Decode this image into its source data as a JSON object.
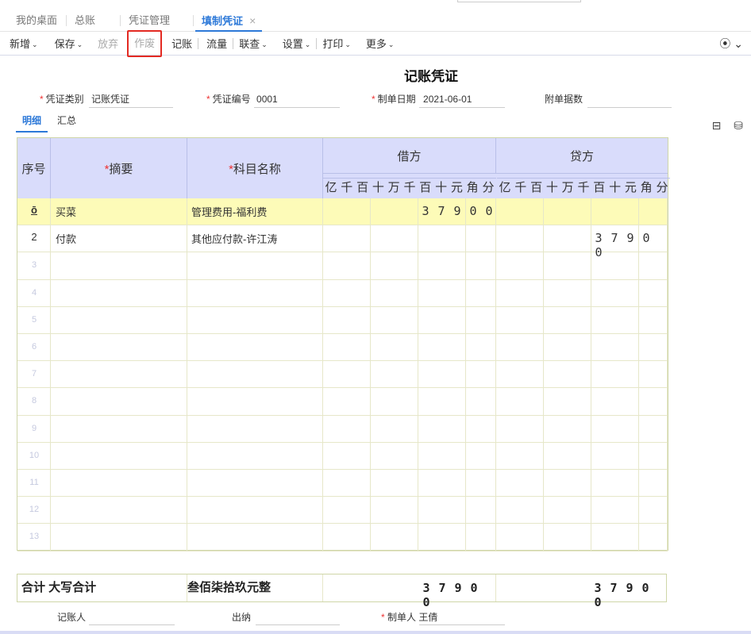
{
  "tabs": [
    {
      "label": "我的桌面"
    },
    {
      "label": "总账"
    },
    {
      "label": "凭证管理"
    },
    {
      "label": "填制凭证",
      "close": "×"
    }
  ],
  "toolbar": {
    "items": [
      {
        "label": "新增",
        "caret": "⌄"
      },
      {
        "label": "保存",
        "caret": "⌄"
      },
      {
        "label": "放弃"
      },
      {
        "label": "作废"
      },
      {
        "label": "记账"
      },
      {
        "label": "流量"
      },
      {
        "label": "联查",
        "caret": "⌄"
      },
      {
        "label": "设置",
        "caret": "⌄"
      },
      {
        "label": "打印",
        "caret": "⌄"
      },
      {
        "label": "更多",
        "caret": "⌄"
      }
    ],
    "right_icon": "⦿ ⌄"
  },
  "voucher": {
    "title": "记账凭证",
    "type_label": "凭证类别",
    "type_value": "记账凭证",
    "number_label": "凭证编号",
    "number_value": "0001",
    "date_label": "制单日期",
    "date_value": "2021-06-01",
    "attach_label": "附单据数",
    "attach_value": ""
  },
  "subtabs": [
    "明细",
    "汇总"
  ],
  "side_icons": "⊟ ⛁",
  "grid": {
    "headers": {
      "seq": "序号",
      "summary": "摘要",
      "account": "科目名称",
      "debit": "借方",
      "credit": "贷方",
      "digits": [
        "亿",
        "千",
        "百",
        "十",
        "万",
        "千",
        "百",
        "十",
        "元",
        "角",
        "分"
      ]
    },
    "rows": [
      {
        "seq": "ō",
        "summary": "买菜",
        "account": "管理费用-福利费",
        "debit": [
          "3",
          "7",
          "9",
          "0",
          "0"
        ],
        "credit": []
      },
      {
        "seq": "2",
        "summary": "付款",
        "account": "其他应付款-许江涛",
        "debit": [],
        "credit": [
          "3",
          "7",
          "9",
          "0",
          "0"
        ]
      },
      {
        "seq": "3"
      },
      {
        "seq": "4"
      },
      {
        "seq": "5"
      },
      {
        "seq": "6"
      },
      {
        "seq": "7"
      },
      {
        "seq": "8"
      },
      {
        "seq": "9"
      },
      {
        "seq": "10"
      },
      {
        "seq": "11"
      },
      {
        "seq": "12"
      },
      {
        "seq": "13"
      }
    ]
  },
  "totals": {
    "label": "合计 大写合计",
    "amount_text": "叁佰柒拾玖元整",
    "debit": [
      "3",
      "7",
      "9",
      "0",
      "0"
    ],
    "credit": [
      "3",
      "7",
      "9",
      "0",
      "0"
    ]
  },
  "footer": {
    "bookkeeper_label": "记账人",
    "bookkeeper_value": "",
    "cashier_label": "出纳",
    "cashier_value": "",
    "maker_label": "制单人",
    "maker_value": "王倩"
  }
}
